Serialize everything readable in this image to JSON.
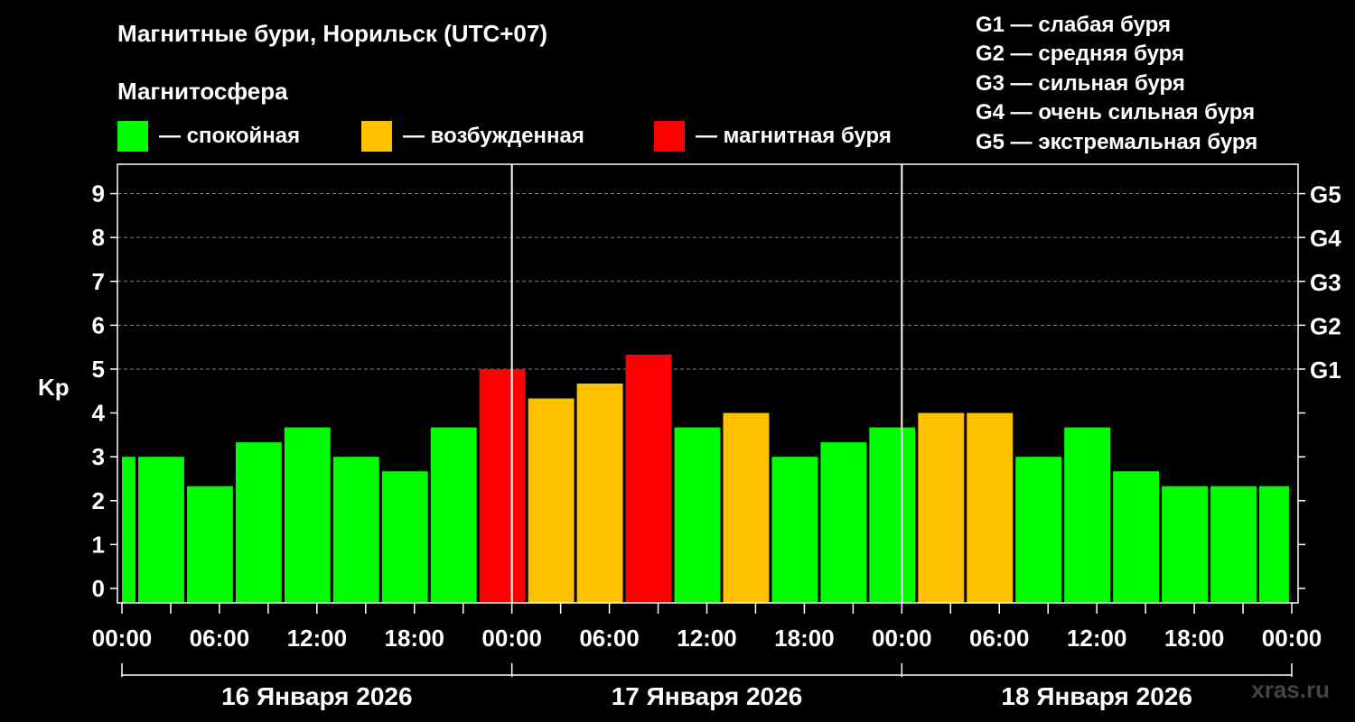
{
  "title": "Магнитные бури, Норильск (UTC+07)",
  "magnetosphere_label": "Магнитосфера",
  "legend": [
    {
      "label": "— спокойная",
      "color": "#00ff00"
    },
    {
      "label": "— возбужденная",
      "color": "#ffc000"
    },
    {
      "label": "— магнитная буря",
      "color": "#ff0000"
    }
  ],
  "g_legend": [
    "G1 — слабая буря",
    "G2 — средняя буря",
    "G3 — сильная буря",
    "G4 — очень сильная буря",
    "G5 — экстремальная буря"
  ],
  "watermark": "xras.ru",
  "chart_data": {
    "type": "bar",
    "ylabel": "Kp",
    "ylim": [
      -0.33,
      9.67
    ],
    "y_ticks": [
      0,
      1,
      2,
      3,
      4,
      5,
      6,
      7,
      8,
      9
    ],
    "y_right_ticks": [
      {
        "value": 5,
        "label": "G1"
      },
      {
        "value": 6,
        "label": "G2"
      },
      {
        "value": 7,
        "label": "G3"
      },
      {
        "value": 8,
        "label": "G4"
      },
      {
        "value": 9,
        "label": "G5"
      }
    ],
    "x_range_hours": [
      0,
      72
    ],
    "x_tick_labels": [
      "00:00",
      "06:00",
      "12:00",
      "18:00",
      "00:00",
      "06:00",
      "12:00",
      "18:00",
      "00:00",
      "06:00",
      "12:00",
      "18:00",
      "00:00"
    ],
    "day_labels": [
      "16 Января 2026",
      "17 Января 2026",
      "18 Января 2026"
    ],
    "grid": "horizontal dashed at G levels",
    "bars": [
      {
        "start_hour": 0,
        "value": 3.0,
        "status": "calm"
      },
      {
        "start_hour": 1,
        "value": 3.0,
        "status": "calm"
      },
      {
        "start_hour": 4,
        "value": 2.33,
        "status": "calm"
      },
      {
        "start_hour": 7,
        "value": 3.33,
        "status": "calm"
      },
      {
        "start_hour": 10,
        "value": 3.67,
        "status": "calm"
      },
      {
        "start_hour": 13,
        "value": 3.0,
        "status": "calm"
      },
      {
        "start_hour": 16,
        "value": 2.67,
        "status": "calm"
      },
      {
        "start_hour": 19,
        "value": 3.67,
        "status": "calm"
      },
      {
        "start_hour": 22,
        "value": 5.0,
        "status": "storm"
      },
      {
        "start_hour": 25,
        "value": 4.33,
        "status": "disturbed"
      },
      {
        "start_hour": 28,
        "value": 4.67,
        "status": "disturbed"
      },
      {
        "start_hour": 31,
        "value": 5.33,
        "status": "storm"
      },
      {
        "start_hour": 34,
        "value": 3.67,
        "status": "calm"
      },
      {
        "start_hour": 37,
        "value": 4.0,
        "status": "disturbed"
      },
      {
        "start_hour": 40,
        "value": 3.0,
        "status": "calm"
      },
      {
        "start_hour": 43,
        "value": 3.33,
        "status": "calm"
      },
      {
        "start_hour": 46,
        "value": 3.67,
        "status": "calm"
      },
      {
        "start_hour": 49,
        "value": 4.0,
        "status": "disturbed"
      },
      {
        "start_hour": 52,
        "value": 4.0,
        "status": "disturbed"
      },
      {
        "start_hour": 55,
        "value": 3.0,
        "status": "calm"
      },
      {
        "start_hour": 58,
        "value": 3.67,
        "status": "calm"
      },
      {
        "start_hour": 61,
        "value": 2.67,
        "status": "calm"
      },
      {
        "start_hour": 64,
        "value": 2.33,
        "status": "calm"
      },
      {
        "start_hour": 67,
        "value": 2.33,
        "status": "calm"
      },
      {
        "start_hour": 70,
        "value": 2.33,
        "status": "calm"
      }
    ],
    "bar_end_hours": [
      0.83,
      3.83,
      6.83,
      9.83,
      12.83,
      15.83,
      18.83,
      21.83,
      24.83,
      27.83,
      30.83,
      33.83,
      36.83,
      39.83,
      42.83,
      45.83,
      48.83,
      51.83,
      54.83,
      57.83,
      60.83,
      63.83,
      66.83,
      69.83,
      71.83
    ],
    "status_colors": {
      "calm": "#00ff00",
      "disturbed": "#ffc000",
      "storm": "#ff0000"
    }
  }
}
